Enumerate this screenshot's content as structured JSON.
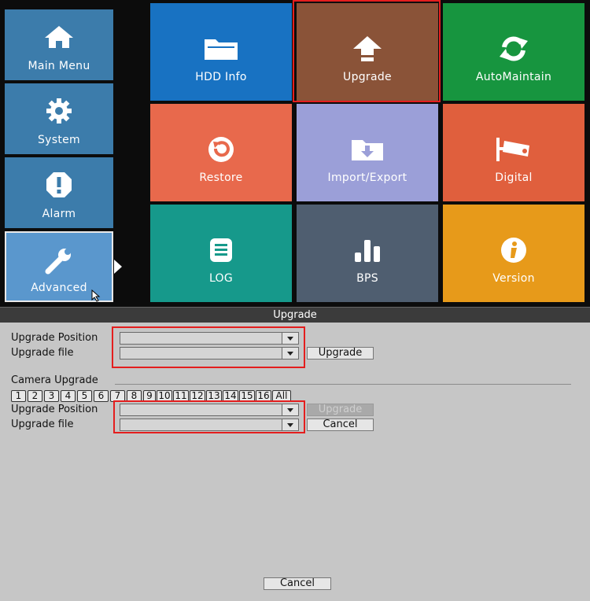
{
  "sidebar": {
    "items": [
      {
        "label": "Main Menu",
        "icon": "home-icon",
        "color": "#3c7cab"
      },
      {
        "label": "System",
        "icon": "gear-icon",
        "color": "#3c7cab"
      },
      {
        "label": "Alarm",
        "icon": "alert-icon",
        "color": "#3c7cab"
      },
      {
        "label": "Advanced",
        "icon": "wrench-icon",
        "color": "#5a97cd",
        "selected": true
      }
    ]
  },
  "tiles": [
    {
      "label": "HDD Info",
      "icon": "folder-icon",
      "color": "#1872c2"
    },
    {
      "label": "Upgrade",
      "icon": "upload-icon",
      "color": "#8a5338",
      "highlighted": true
    },
    {
      "label": "AutoMaintain",
      "icon": "refresh-icon",
      "color": "#17953f"
    },
    {
      "label": "Restore",
      "icon": "restore-icon",
      "color": "#e8694c"
    },
    {
      "label": "Import/Export",
      "icon": "import-export-icon",
      "color": "#9b9fd8"
    },
    {
      "label": "Digital",
      "icon": "camera-icon",
      "color": "#e05f3d"
    },
    {
      "label": "LOG",
      "icon": "log-icon",
      "color": "#16998b"
    },
    {
      "label": "BPS",
      "icon": "bars-icon",
      "color": "#4f5e70"
    },
    {
      "label": "Version",
      "icon": "info-icon",
      "color": "#e79a1a"
    }
  ],
  "dialog": {
    "title": "Upgrade",
    "upgrade_position_label": "Upgrade Position",
    "upgrade_file_label": "Upgrade file",
    "upgrade_position_value": "",
    "upgrade_file_value": "",
    "upgrade_button": "Upgrade",
    "camera_upgrade_label": "Camera Upgrade",
    "channels": [
      "1",
      "2",
      "3",
      "4",
      "5",
      "6",
      "7",
      "8",
      "9",
      "10",
      "11",
      "12",
      "13",
      "14",
      "15",
      "16",
      "All"
    ],
    "camera_position_label": "Upgrade Position",
    "camera_file_label": "Upgrade file",
    "camera_upgrade_button": "Upgrade",
    "camera_cancel_button": "Cancel",
    "cancel_button": "Cancel"
  },
  "colors": {
    "highlight": "#e41e1e",
    "panel_bg": "#c6c6c6"
  }
}
